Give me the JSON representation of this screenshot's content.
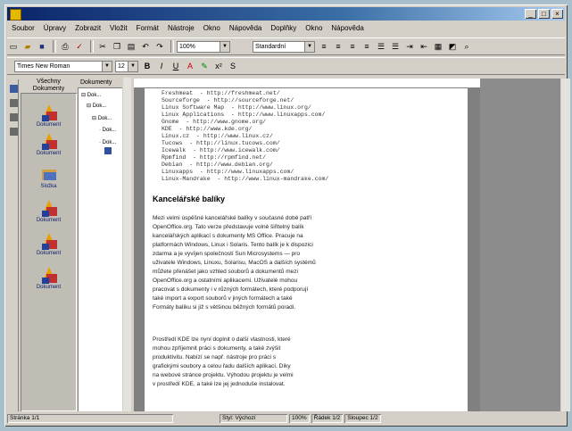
{
  "menu": [
    "Soubor",
    "Úpravy",
    "Zobrazit",
    "Vložit",
    "Formát",
    "Nástroje",
    "Okno",
    "Nápověda",
    "Doplňky",
    "Okno",
    "Nápověda"
  ],
  "toolbar1": {
    "zoom": "100%",
    "style": "Standardní"
  },
  "toolbar2": {
    "font": "Times New Roman",
    "size": "12"
  },
  "shortcut_bar": {
    "header": "Všechny Dokumenty",
    "items": [
      "Dokument",
      "Dokument",
      "Složka",
      "Dokument",
      "Dokument",
      "Dokument"
    ]
  },
  "tree": {
    "header": "Dokumenty",
    "nodes": [
      "Dok...",
      "Dok...",
      "Dok...",
      "Dok...",
      "Dok..."
    ]
  },
  "urls": [
    [
      "Freshmeat",
      "- http://freshmeat.net/"
    ],
    [
      "Sourceforge",
      "- http://sourceforge.net/"
    ],
    [
      "Linux Software Map",
      "- http://www.linux.org/"
    ],
    [
      "Linux Applications",
      "- http://www.linuxapps.com/"
    ],
    [
      "Gnome",
      "- http://www.gnome.org/"
    ],
    [
      "KDE",
      "- http://www.kde.org/"
    ],
    [
      "Linux.cz",
      "- http://www.linux.cz/"
    ],
    [
      "Tucows",
      "- http://linux.tucows.com/"
    ],
    [
      "Icewalk",
      "- http://www.icewalk.com/"
    ],
    [
      "Rpmfind",
      "- http://rpmfind.net/"
    ],
    [
      "Debian",
      "- http://www.debian.org/"
    ],
    [
      "Linuxapps",
      "- http://www.linuxapps.com/"
    ],
    [
      "Linux-Mandrake",
      "- http://www.linux-mandrake.com/"
    ]
  ],
  "heading": "Kancelářské balíky",
  "paragraph1": [
    "Mezi velmi úspěšné kancelářské balíky v současné době patří",
    "OpenOffice.org. Tato verze představuje volně šiřitelný balík",
    "kancelářských aplikací s dokumenty MS Office. Pracuje na",
    "platformách Windows, Linux i Solaris. Tento balík je k dispozici",
    "zdarma a je vyvíjen společností Sun Microsystems — pro",
    "uživatele Windows, Linuxu, Solarisu, MacOS a dalších systémů",
    "můžete přenášet jako vzhled souborů a dokumentů mezi",
    "OpenOffice.org a ostatními aplikacemi. Uživatelé mohou",
    "pracovat s dokumenty i v různých formátech, které podporují",
    "také import a export souborů v jiných formátech a také",
    "Formáty balíku si již s většinou běžných formátů poradí."
  ],
  "paragraph2": [
    "Prostředí KDE lze nyní doplnit o další vlastnosti, které",
    "mohou zpříjemnit práci s dokumenty, a také zvýšit",
    "produktivitu. Nabízí se např. nástroje pro práci s",
    "grafickými soubory a celou řadu dalších aplikací. Díky",
    "na webové stránce projektu. Výhodou projektu je velmi",
    "v prostředí KDE, a také lze jej jednoduše instalovat."
  ],
  "status": [
    "Stránka 1/1",
    "Styl: Výchozí",
    "100%",
    "Řádek 1/2",
    "Sloupec 1/2"
  ]
}
